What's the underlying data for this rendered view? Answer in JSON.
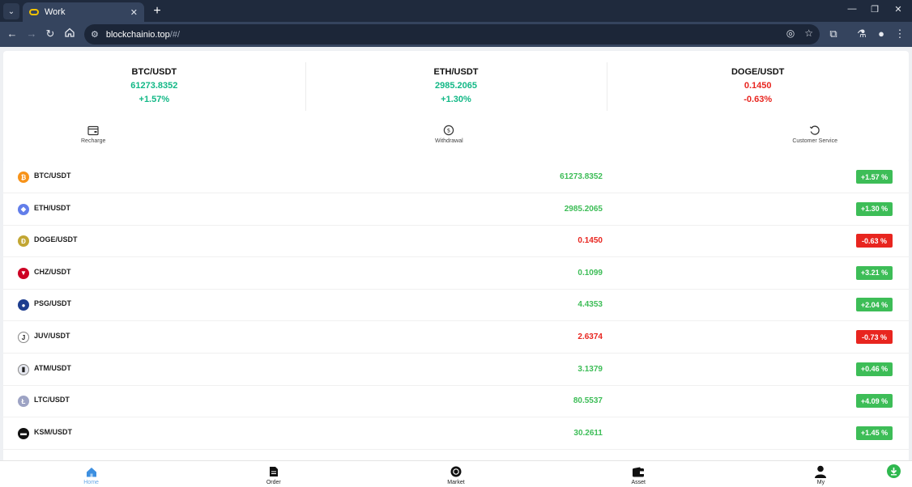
{
  "browser": {
    "tab_title": "Work",
    "url_host": "blockchainio.top",
    "url_path": "/#/"
  },
  "tickers": [
    {
      "pair": "BTC/USDT",
      "price": "61273.8352",
      "change": "+1.57%",
      "direction": "up"
    },
    {
      "pair": "ETH/USDT",
      "price": "2985.2065",
      "change": "+1.30%",
      "direction": "up"
    },
    {
      "pair": "DOGE/USDT",
      "price": "0.1450",
      "change": "-0.63%",
      "direction": "down"
    }
  ],
  "actions": [
    {
      "label": "Recharge",
      "icon": "recharge-icon"
    },
    {
      "label": "Withdrawal",
      "icon": "withdrawal-icon"
    },
    {
      "label": "Customer Service",
      "icon": "customer-service-icon"
    }
  ],
  "market": [
    {
      "pair": "BTC/USDT",
      "price": "61273.8352",
      "change": "+1.57 %",
      "direction": "up",
      "icon_color": "#f7931a",
      "icon_glyph": "₿"
    },
    {
      "pair": "ETH/USDT",
      "price": "2985.2065",
      "change": "+1.30 %",
      "direction": "up",
      "icon_color": "#627eea",
      "icon_glyph": "◆"
    },
    {
      "pair": "DOGE/USDT",
      "price": "0.1450",
      "change": "-0.63 %",
      "direction": "down",
      "icon_color": "#c2a633",
      "icon_glyph": "Ð"
    },
    {
      "pair": "CHZ/USDT",
      "price": "0.1099",
      "change": "+3.21 %",
      "direction": "up",
      "icon_color": "#cd0124",
      "icon_glyph": "▼"
    },
    {
      "pair": "PSG/USDT",
      "price": "4.4353",
      "change": "+2.04 %",
      "direction": "up",
      "icon_color": "#1d3d8f",
      "icon_glyph": "●"
    },
    {
      "pair": "JUV/USDT",
      "price": "2.6374",
      "change": "-0.73 %",
      "direction": "down",
      "icon_color": "#ffffff",
      "icon_glyph": "J"
    },
    {
      "pair": "ATM/USDT",
      "price": "3.1379",
      "change": "+0.46 %",
      "direction": "up",
      "icon_color": "#e8eaf2",
      "icon_glyph": "▮"
    },
    {
      "pair": "LTC/USDT",
      "price": "80.5537",
      "change": "+4.09 %",
      "direction": "up",
      "icon_color": "#9da3c4",
      "icon_glyph": "Ł"
    },
    {
      "pair": "KSM/USDT",
      "price": "30.2611",
      "change": "+1.45 %",
      "direction": "up",
      "icon_color": "#111111",
      "icon_glyph": "▬"
    }
  ],
  "bottom_nav": [
    {
      "label": "Home",
      "icon": "home-icon",
      "active": true
    },
    {
      "label": "Order",
      "icon": "order-icon",
      "active": false
    },
    {
      "label": "Market",
      "icon": "market-icon",
      "active": false
    },
    {
      "label": "Asset",
      "icon": "wallet-icon",
      "active": false
    },
    {
      "label": "My",
      "icon": "user-icon",
      "active": false
    }
  ],
  "colors": {
    "up_text": "#12b886",
    "down_text": "#e8251f",
    "up_badge": "#3dbd57",
    "down_badge": "#e8251f",
    "active_tab": "#6aa8e6"
  }
}
